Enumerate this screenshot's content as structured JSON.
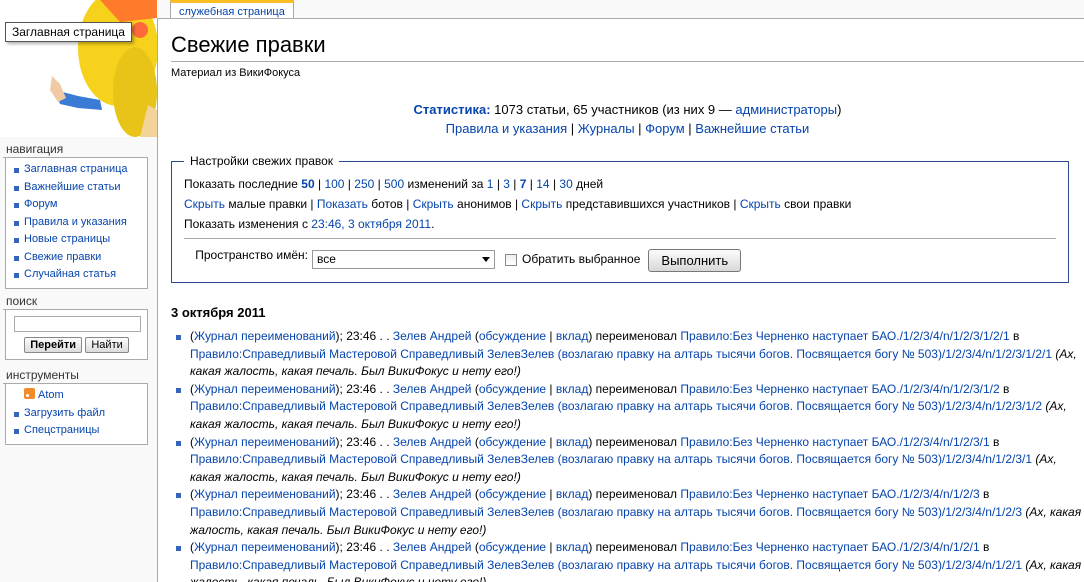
{
  "logo": {
    "home_tooltip": "Заглавная страница"
  },
  "tab": {
    "label": "служебная страница"
  },
  "navigation": {
    "title": "навигация",
    "items": [
      "Заглавная страница",
      "Важнейшие статьи",
      "Форум",
      "Правила и указания",
      "Новые страницы",
      "Свежие правки",
      "Случайная статья"
    ]
  },
  "search": {
    "title": "поиск",
    "go": "Перейти",
    "find": "Найти",
    "value": ""
  },
  "tools": {
    "title": "инструменты",
    "items": [
      "Atom",
      "Загрузить файл",
      "Спецстраницы"
    ]
  },
  "page": {
    "title": "Свежие правки",
    "subtitle": "Материал из ВикиФокуса"
  },
  "stats": {
    "label": "Статистика:",
    "text": "1073 статьи, 65 участников (из них 9 —",
    "admins": "администраторы",
    "close": ")",
    "links": [
      "Правила и указания",
      "Журналы",
      "Форум",
      "Важнейшие статьи"
    ]
  },
  "settings": {
    "legend": "Настройки свежих правок",
    "show_last": "Показать последние",
    "limits": [
      "50",
      "100",
      "250",
      "500"
    ],
    "changes_for": "изменений за",
    "days": [
      "1",
      "3",
      "7",
      "14",
      "30"
    ],
    "days_word": "дней",
    "hide": "Скрыть",
    "show": "Показать",
    "minor": "малые правки",
    "bots": "ботов",
    "anons": "анонимов",
    "loggedin": "представившихся участников",
    "mine": "свои правки",
    "since_prefix": "Показать изменения с",
    "since_link": "23:46, 3 октября 2011",
    "namespace_label": "Пространство имён:",
    "namespace_value": "все",
    "invert_label": "Обратить выбранное",
    "run": "Выполнить"
  },
  "date_heading": "3 октября 2011",
  "changes": [
    {
      "log": "Журнал переименований",
      "time": "23:46",
      "user": "Зелев Андрей",
      "talk": "обсуждение",
      "contribs": "вклад",
      "action": "переименовал",
      "from": "Правило:Без Черненко наступает БАО./1/2/3/4/n/1/2/3/1/2/1",
      "to": "Правило:Справедливый Мастеровой Справедливый ЗелевЗелев (возлагаю правку на алтарь тысячи богов. Посвящается богу № 503)/1/2/3/4/n/1/2/3/1/2/1",
      "comment": "(Ах, какая жалость, какая печаль. Был ВикиФокус и нету его!)"
    },
    {
      "log": "Журнал переименований",
      "time": "23:46",
      "user": "Зелев Андрей",
      "talk": "обсуждение",
      "contribs": "вклад",
      "action": "переименовал",
      "from": "Правило:Без Черненко наступает БАО./1/2/3/4/n/1/2/3/1/2",
      "to": "Правило:Справедливый Мастеровой Справедливый ЗелевЗелев (возлагаю правку на алтарь тысячи богов. Посвящается богу № 503)/1/2/3/4/n/1/2/3/1/2",
      "comment": "(Ах, какая жалость, какая печаль. Был ВикиФокус и нету его!)"
    },
    {
      "log": "Журнал переименований",
      "time": "23:46",
      "user": "Зелев Андрей",
      "talk": "обсуждение",
      "contribs": "вклад",
      "action": "переименовал",
      "from": "Правило:Без Черненко наступает БАО./1/2/3/4/n/1/2/3/1",
      "to": "Правило:Справедливый Мастеровой Справедливый ЗелевЗелев (возлагаю правку на алтарь тысячи богов. Посвящается богу № 503)/1/2/3/4/n/1/2/3/1",
      "comment": "(Ах, какая жалость, какая печаль. Был ВикиФокус и нету его!)"
    },
    {
      "log": "Журнал переименований",
      "time": "23:46",
      "user": "Зелев Андрей",
      "talk": "обсуждение",
      "contribs": "вклад",
      "action": "переименовал",
      "from": "Правило:Без Черненко наступает БАО./1/2/3/4/n/1/2/3",
      "to": "Правило:Справедливый Мастеровой Справедливый ЗелевЗелев (возлагаю правку на алтарь тысячи богов. Посвящается богу № 503)/1/2/3/4/n/1/2/3",
      "comment": "(Ах, какая жалость, какая печаль. Был ВикиФокус и нету его!)"
    },
    {
      "log": "Журнал переименований",
      "time": "23:46",
      "user": "Зелев Андрей",
      "talk": "обсуждение",
      "contribs": "вклад",
      "action": "переименовал",
      "from": "Правило:Без Черненко наступает БАО./1/2/3/4/n/1/2/1",
      "to": "Правило:Справедливый Мастеровой Справедливый ЗелевЗелев (возлагаю правку на алтарь тысячи богов. Посвящается богу № 503)/1/2/3/4/n/1/2/1",
      "comment": "(Ах, какая жалость, какая печаль. Был ВикиФокус и нету его!)"
    }
  ]
}
